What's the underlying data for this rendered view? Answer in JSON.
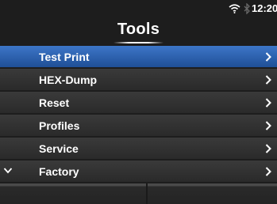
{
  "status_bar": {
    "wifi_icon": "wifi-icon",
    "bluetooth_icon": "bluetooth-icon",
    "time": "12:20"
  },
  "header": {
    "title": "Tools"
  },
  "menu": {
    "items": [
      {
        "label": "Test Print",
        "selected": true
      },
      {
        "label": "HEX-Dump"
      },
      {
        "label": "Reset"
      },
      {
        "label": "Profiles"
      },
      {
        "label": "Service"
      },
      {
        "label": "Factory",
        "scroll_indicator": "chevron-down-icon"
      }
    ],
    "item_icon": "chevron-right-icon"
  },
  "softkeys": {
    "left_label": "",
    "right_label": ""
  },
  "colors": {
    "selected_bg": "#2c63b3",
    "item_bg": "#303030",
    "background": "#1d1d1d",
    "text": "#ffffff"
  }
}
